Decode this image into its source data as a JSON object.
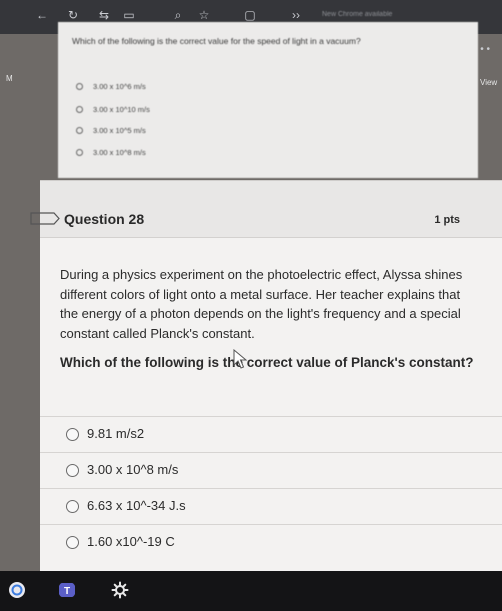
{
  "browser": {
    "status_text": "New Chrome available",
    "more_menu": "• • •"
  },
  "side_labels": {
    "left_letter": "M",
    "right_view": "View"
  },
  "previous_question": {
    "prompt": "Which of the following is the correct value for the speed of light in a vacuum?",
    "options": [
      "3.00 x 10^6 m/s",
      "3.00 x 10^10 m/s",
      "3.00 x 10^5 m/s",
      "3.00 x 10^8 m/s"
    ]
  },
  "question": {
    "title": "Question 28",
    "points": "1 pts",
    "body": "During a physics experiment on the photoelectric effect, Alyssa shines different colors of light onto a metal surface. Her teacher explains that the energy of a photon depends on the light's frequency and a special constant called Planck's constant.",
    "ask": "Which of the following is the correct value of Planck's constant?",
    "answers": [
      "9.81 m/s2",
      "3.00 x 10^8 m/s",
      "6.63 x 10^-34 J.s",
      "1.60 x10^-19 C"
    ]
  },
  "taskbar": {
    "apps": [
      "start-circle-icon",
      "teams-icon",
      "settings-gear-icon"
    ]
  },
  "colors": {
    "background_dark": "#6e6a67",
    "card": "#f3f2f1",
    "header": "#e8e7e6",
    "taskbar": "#141416",
    "teams": "#5b5fc7"
  }
}
